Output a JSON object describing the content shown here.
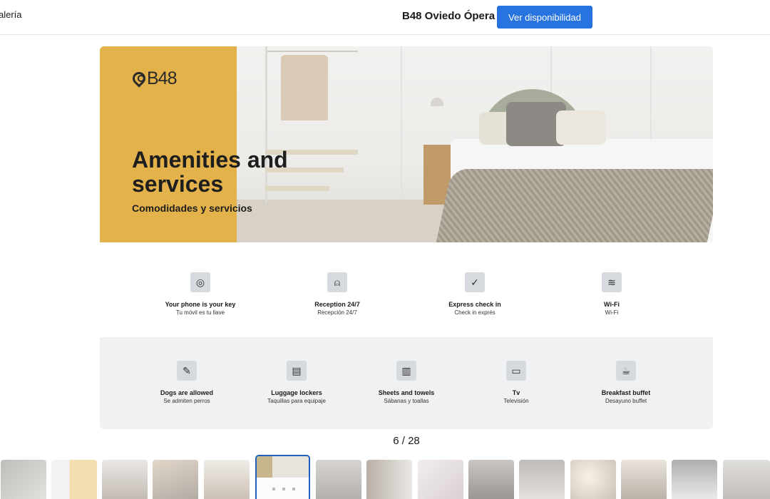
{
  "header": {
    "gallery_label": "alería",
    "hotel_name": "B48 Oviedo Ópera",
    "cta_label": "Ver disponibilidad"
  },
  "banner": {
    "logo_text": "B48",
    "heading": "Amenities and services",
    "subheading": "Comodidades y servicios"
  },
  "amenities_row1": [
    {
      "icon": "fingerprint-icon",
      "glyph": "◎",
      "title": "Your phone is your key",
      "subtitle": "Tu móvil es tu llave"
    },
    {
      "icon": "bell-icon",
      "glyph": "⍝",
      "title": "Reception 24/7",
      "subtitle": "Recepción 24/7"
    },
    {
      "icon": "check-clock-icon",
      "glyph": "✓",
      "title": "Express check in",
      "subtitle": "Check in exprés"
    },
    {
      "icon": "wifi-icon",
      "glyph": "≋",
      "title": "Wi-Fi",
      "subtitle": "Wi-Fi"
    }
  ],
  "amenities_row2": [
    {
      "icon": "dog-icon",
      "glyph": "✎",
      "title": "Dogs are allowed",
      "subtitle": "Se admiten perros"
    },
    {
      "icon": "locker-icon",
      "glyph": "▤",
      "title": "Luggage lockers",
      "subtitle": "Taquillas para equipaje"
    },
    {
      "icon": "towel-icon",
      "glyph": "▥",
      "title": "Sheets and towels",
      "subtitle": "Sábanas y toallas"
    },
    {
      "icon": "tv-icon",
      "glyph": "▭",
      "title": "Tv",
      "subtitle": "Televisión"
    },
    {
      "icon": "coffee-cup-icon",
      "glyph": "☕",
      "title": "Breakfast buffet",
      "subtitle": "Desayuno buffet"
    }
  ],
  "gallery": {
    "counter": "6 / 28",
    "active_index": 5
  },
  "colors": {
    "accent": "#2774e0",
    "banner_yellow": "#e3b24a",
    "active_thumb_border": "#1f5fc0"
  }
}
